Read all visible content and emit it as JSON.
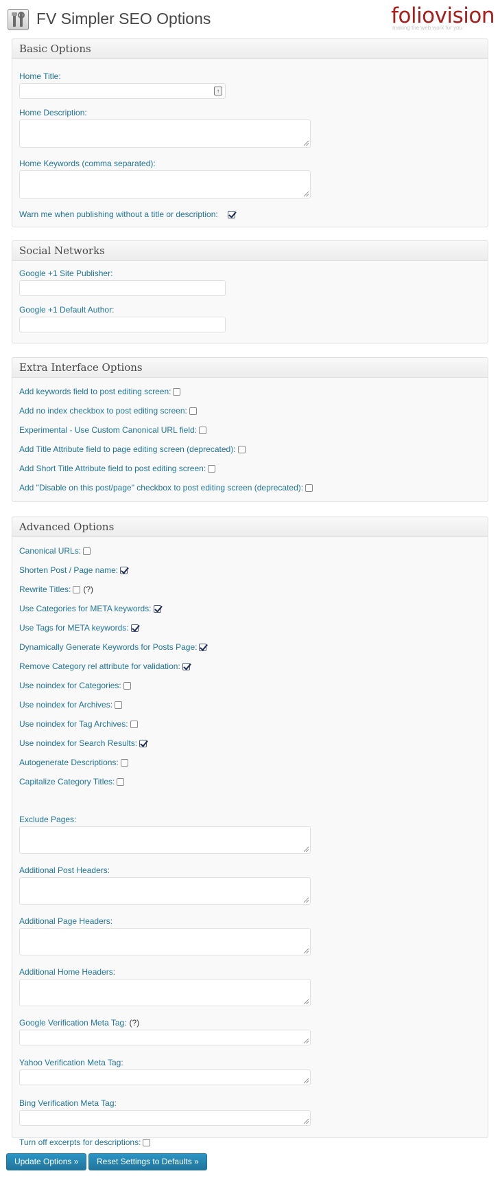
{
  "app": {
    "title": "FV Simpler SEO Options",
    "logo_name": "foliovision",
    "logo_tagline": "making the web work for you",
    "icon": "tools-icon"
  },
  "colors": {
    "accent": "#21759b",
    "logo": "#a71e1b",
    "title": "#464646",
    "panel_bg": "#f9f9f9",
    "border": "#dfdfdf"
  },
  "basic": {
    "heading": "Basic Options",
    "home_title_label": "Home Title:",
    "home_title_value": "",
    "home_desc_label": "Home Description:",
    "home_desc_value": "",
    "home_keywords_label": "Home Keywords (comma separated):",
    "home_keywords_value": "",
    "warn_label": "Warn me when publishing without a title or description:",
    "warn_checked": true
  },
  "social": {
    "heading": "Social Networks",
    "publisher_label": "Google +1 Site Publisher:",
    "publisher_value": "",
    "author_label": "Google +1 Default Author:",
    "author_value": ""
  },
  "extra": {
    "heading": "Extra Interface Options",
    "items": [
      {
        "label": "Add keywords field to post editing screen:",
        "checked": false
      },
      {
        "label": "Add no index checkbox to post editing screen:",
        "checked": false
      },
      {
        "label": "Experimental - Use Custom Canonical URL field:",
        "checked": false
      },
      {
        "label": "Add Title Attribute field to page editing screen (deprecated):",
        "checked": false
      },
      {
        "label": "Add Short Title Attribute field to post editing screen:",
        "checked": false
      },
      {
        "label": "Add \"Disable on this post/page\" checkbox to post editing screen (deprecated):",
        "checked": false
      }
    ]
  },
  "advanced": {
    "heading": "Advanced Options",
    "help_text": "(?)",
    "items": [
      {
        "label": "Canonical URLs:",
        "checked": false
      },
      {
        "label": "Shorten Post / Page name:",
        "checked": true
      },
      {
        "label": "Rewrite Titles:",
        "checked": false
      },
      {
        "label": "Use Categories for META keywords:",
        "checked": true
      },
      {
        "label": "Use Tags for META keywords:",
        "checked": true
      },
      {
        "label": "Dynamically Generate Keywords for Posts Page:",
        "checked": true
      },
      {
        "label": "Remove Category rel attribute for validation:",
        "checked": true
      },
      {
        "label": "Use noindex for Categories:",
        "checked": false
      },
      {
        "label": "Use noindex for Archives:",
        "checked": false
      },
      {
        "label": "Use noindex for Tag Archives:",
        "checked": false
      },
      {
        "label": "Use noindex for Search Results:",
        "checked": true
      },
      {
        "label": "Autogenerate Descriptions:",
        "checked": false
      },
      {
        "label": "Capitalize Category Titles:",
        "checked": false
      }
    ],
    "exclude_pages_label": "Exclude Pages:",
    "post_headers_label": "Additional Post Headers:",
    "page_headers_label": "Additional Page Headers:",
    "home_headers_label": "Additional Home Headers:",
    "google_verif_label": "Google Verification Meta Tag:",
    "yahoo_verif_label": "Yahoo Verification Meta Tag:",
    "bing_verif_label": "Bing Verification Meta Tag:",
    "excerpts_label": "Turn off excerpts for descriptions:",
    "excerpts_checked": false
  },
  "buttons": {
    "update": "Update Options »",
    "reset": "Reset Settings to Defaults »"
  }
}
